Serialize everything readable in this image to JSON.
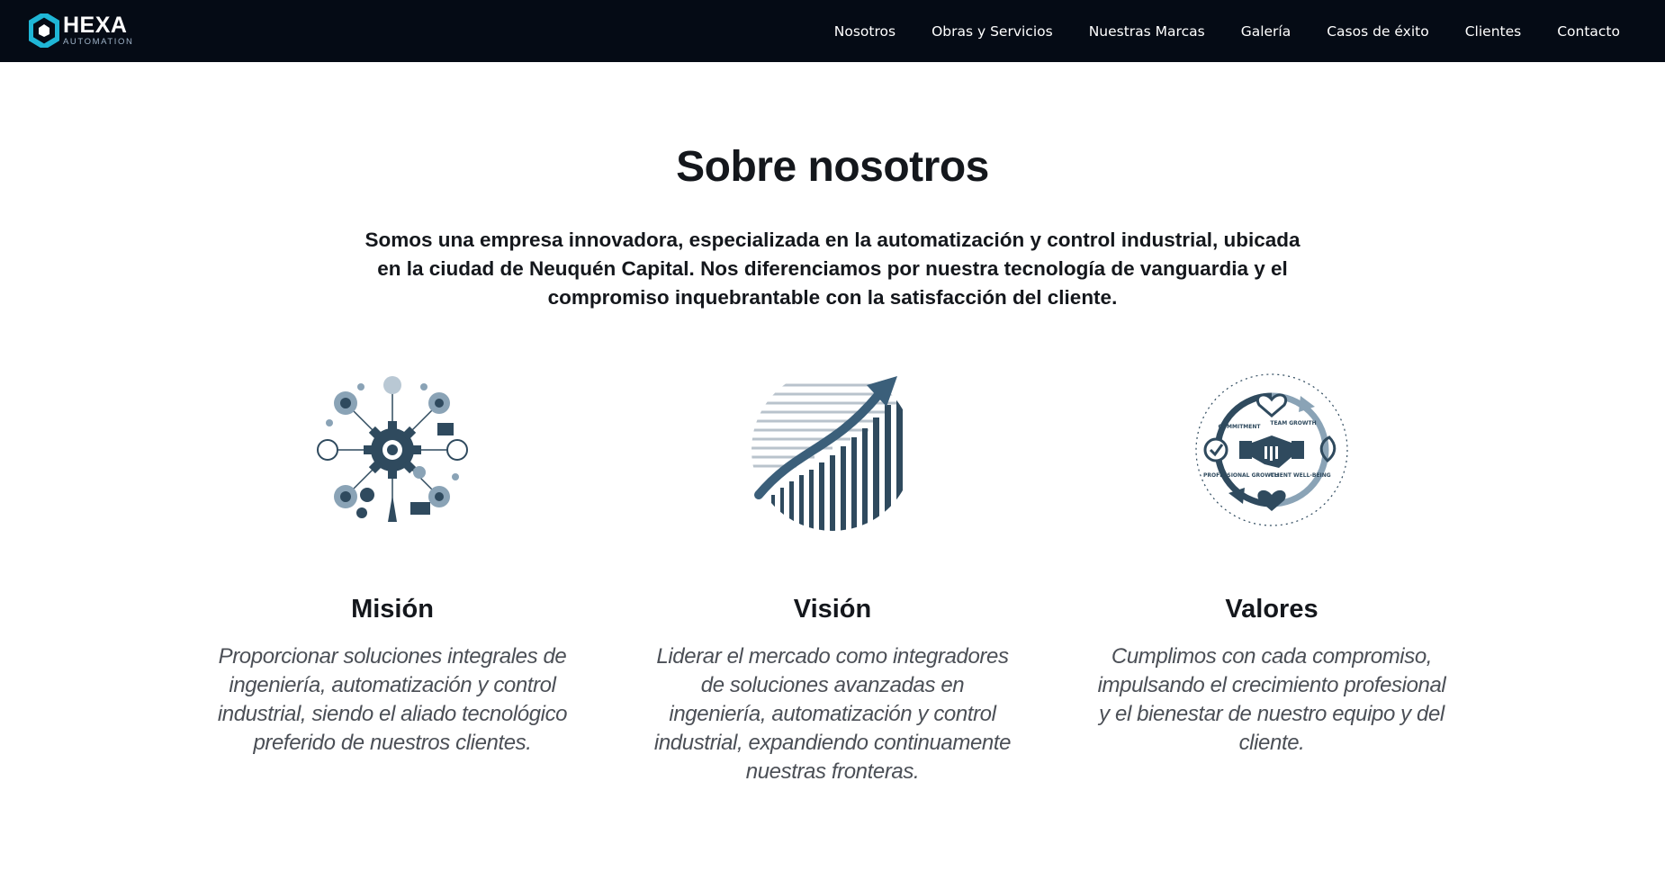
{
  "nav": {
    "logo_name": "HEXA",
    "logo_sub": "AUTOMATION",
    "items": [
      {
        "label": "Nosotros"
      },
      {
        "label": "Obras y Servicios"
      },
      {
        "label": "Nuestras Marcas"
      },
      {
        "label": "Galería"
      },
      {
        "label": "Casos de éxito"
      },
      {
        "label": "Clientes"
      },
      {
        "label": "Contacto"
      }
    ]
  },
  "section": {
    "title": "Sobre nosotros",
    "intro": "Somos una empresa innovadora, especializada en la automatización y control industrial, ubicada en la ciudad de Neuquén Capital. Nos diferenciamos por nuestra tecnología de vanguardia y el compromiso inquebrantable con la satisfacción del cliente."
  },
  "cards": [
    {
      "heading": "Misión",
      "text": "Proporcionar soluciones integrales de ingeniería, automatización y control industrial, siendo el aliado tecnológico preferido de nuestros clientes.",
      "icon": "gears-industry-icon"
    },
    {
      "heading": "Visión",
      "text": "Liderar el mercado como integradores de soluciones avanzadas en ingeniería, automatización y control industrial, expandiendo continuamente nuestras fronteras.",
      "icon": "growth-chart-icon"
    },
    {
      "heading": "Valores",
      "text": "Cumplimos con cada compromiso, impulsando el crecimiento profesional y el bienestar de nuestro equipo y del cliente.",
      "icon": "values-handshake-icon",
      "badge_labels": [
        "COMMITMENT",
        "TEAM GROWTH",
        "PROFESSIONAL GROWTH",
        "CLIENT WELL-BEING"
      ]
    }
  ],
  "colors": {
    "nav_bg": "#050b15",
    "logo_accent": "#1fb6d6",
    "icon_dark": "#2f4a5e",
    "icon_light": "#8aa3b6"
  }
}
